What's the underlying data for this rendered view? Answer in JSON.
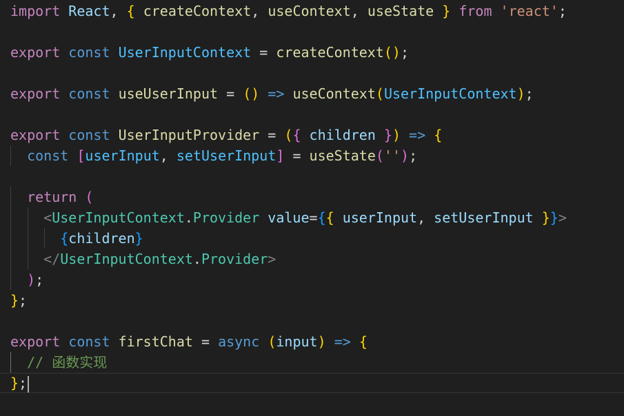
{
  "editor": {
    "theme": {
      "background": "#1f1f1f",
      "keyword": "#c586c0",
      "storage": "#569cd6",
      "function": "#dcdcaa",
      "type": "#4ec9b0",
      "constant": "#4fc1ff",
      "variable": "#9cdcfe",
      "string": "#ce9178",
      "comment": "#6a9955",
      "bracket_1": "#ffd700",
      "bracket_2": "#da70d6",
      "bracket_3": "#179fff"
    },
    "cursor": {
      "line": 19,
      "after_text": "};"
    },
    "lines": [
      [
        [
          "kw",
          "import"
        ],
        [
          "op",
          " "
        ],
        [
          "vr",
          "React"
        ],
        [
          "op",
          ", "
        ],
        [
          "b1",
          "{"
        ],
        [
          "op",
          " "
        ],
        [
          "fn",
          "createContext"
        ],
        [
          "op",
          ", "
        ],
        [
          "fn",
          "useContext"
        ],
        [
          "op",
          ", "
        ],
        [
          "fn",
          "useState"
        ],
        [
          "op",
          " "
        ],
        [
          "b1",
          "}"
        ],
        [
          "op",
          " "
        ],
        [
          "kw",
          "from"
        ],
        [
          "op",
          " "
        ],
        [
          "str",
          "'react'"
        ],
        [
          "op",
          ";"
        ]
      ],
      [],
      [
        [
          "kw",
          "export"
        ],
        [
          "op",
          " "
        ],
        [
          "st",
          "const"
        ],
        [
          "op",
          " "
        ],
        [
          "cv",
          "UserInputContext"
        ],
        [
          "op",
          " = "
        ],
        [
          "fn",
          "createContext"
        ],
        [
          "b1",
          "()"
        ],
        [
          "op",
          ";"
        ]
      ],
      [],
      [
        [
          "kw",
          "export"
        ],
        [
          "op",
          " "
        ],
        [
          "st",
          "const"
        ],
        [
          "op",
          " "
        ],
        [
          "fn",
          "useUserInput"
        ],
        [
          "op",
          " = "
        ],
        [
          "b1",
          "()"
        ],
        [
          "op",
          " "
        ],
        [
          "st",
          "=>"
        ],
        [
          "op",
          " "
        ],
        [
          "fn",
          "useContext"
        ],
        [
          "b1",
          "("
        ],
        [
          "cv",
          "UserInputContext"
        ],
        [
          "b1",
          ")"
        ],
        [
          "op",
          ";"
        ]
      ],
      [],
      [
        [
          "kw",
          "export"
        ],
        [
          "op",
          " "
        ],
        [
          "st",
          "const"
        ],
        [
          "op",
          " "
        ],
        [
          "fn",
          "UserInputProvider"
        ],
        [
          "op",
          " = "
        ],
        [
          "b1",
          "("
        ],
        [
          "b2",
          "{"
        ],
        [
          "op",
          " "
        ],
        [
          "vr",
          "children"
        ],
        [
          "op",
          " "
        ],
        [
          "b2",
          "}"
        ],
        [
          "b1",
          ")"
        ],
        [
          "op",
          " "
        ],
        [
          "st",
          "=>"
        ],
        [
          "op",
          " "
        ],
        [
          "b1",
          "{"
        ]
      ],
      [
        [
          "op",
          "  "
        ],
        [
          "st",
          "const"
        ],
        [
          "op",
          " "
        ],
        [
          "b2",
          "["
        ],
        [
          "cv",
          "userInput"
        ],
        [
          "op",
          ", "
        ],
        [
          "cv",
          "setUserInput"
        ],
        [
          "b2",
          "]"
        ],
        [
          "op",
          " = "
        ],
        [
          "fn",
          "useState"
        ],
        [
          "b2",
          "("
        ],
        [
          "str",
          "''"
        ],
        [
          "b2",
          ")"
        ],
        [
          "op",
          ";"
        ]
      ],
      [],
      [
        [
          "op",
          "  "
        ],
        [
          "kw",
          "return"
        ],
        [
          "op",
          " "
        ],
        [
          "b2",
          "("
        ]
      ],
      [
        [
          "op",
          "    "
        ],
        [
          "tg",
          "<"
        ],
        [
          "ty",
          "UserInputContext"
        ],
        [
          "op",
          "."
        ],
        [
          "ty",
          "Provider"
        ],
        [
          "op",
          " "
        ],
        [
          "vr",
          "value"
        ],
        [
          "op",
          "="
        ],
        [
          "b3",
          "{"
        ],
        [
          "b1",
          "{"
        ],
        [
          "op",
          " "
        ],
        [
          "vr",
          "userInput"
        ],
        [
          "op",
          ", "
        ],
        [
          "vr",
          "setUserInput"
        ],
        [
          "op",
          " "
        ],
        [
          "b1",
          "}"
        ],
        [
          "b3",
          "}"
        ],
        [
          "tg",
          ">"
        ]
      ],
      [
        [
          "op",
          "      "
        ],
        [
          "b3",
          "{"
        ],
        [
          "vr",
          "children"
        ],
        [
          "b3",
          "}"
        ]
      ],
      [
        [
          "op",
          "    "
        ],
        [
          "tg",
          "</"
        ],
        [
          "ty",
          "UserInputContext"
        ],
        [
          "op",
          "."
        ],
        [
          "ty",
          "Provider"
        ],
        [
          "tg",
          ">"
        ]
      ],
      [
        [
          "op",
          "  "
        ],
        [
          "b2",
          ")"
        ],
        [
          "op",
          ";"
        ]
      ],
      [
        [
          "b1",
          "}"
        ],
        [
          "op",
          ";"
        ]
      ],
      [],
      [
        [
          "kw",
          "export"
        ],
        [
          "op",
          " "
        ],
        [
          "st",
          "const"
        ],
        [
          "op",
          " "
        ],
        [
          "fn",
          "firstChat"
        ],
        [
          "op",
          " = "
        ],
        [
          "st",
          "async"
        ],
        [
          "op",
          " "
        ],
        [
          "b1",
          "("
        ],
        [
          "vr",
          "input"
        ],
        [
          "b1",
          ")"
        ],
        [
          "op",
          " "
        ],
        [
          "st",
          "=>"
        ],
        [
          "op",
          " "
        ],
        [
          "b1",
          "{"
        ]
      ],
      [
        [
          "op",
          "  "
        ],
        [
          "cm",
          "// 函数实现"
        ]
      ],
      [
        [
          "b1",
          "}"
        ],
        [
          "op",
          ";"
        ]
      ]
    ]
  }
}
